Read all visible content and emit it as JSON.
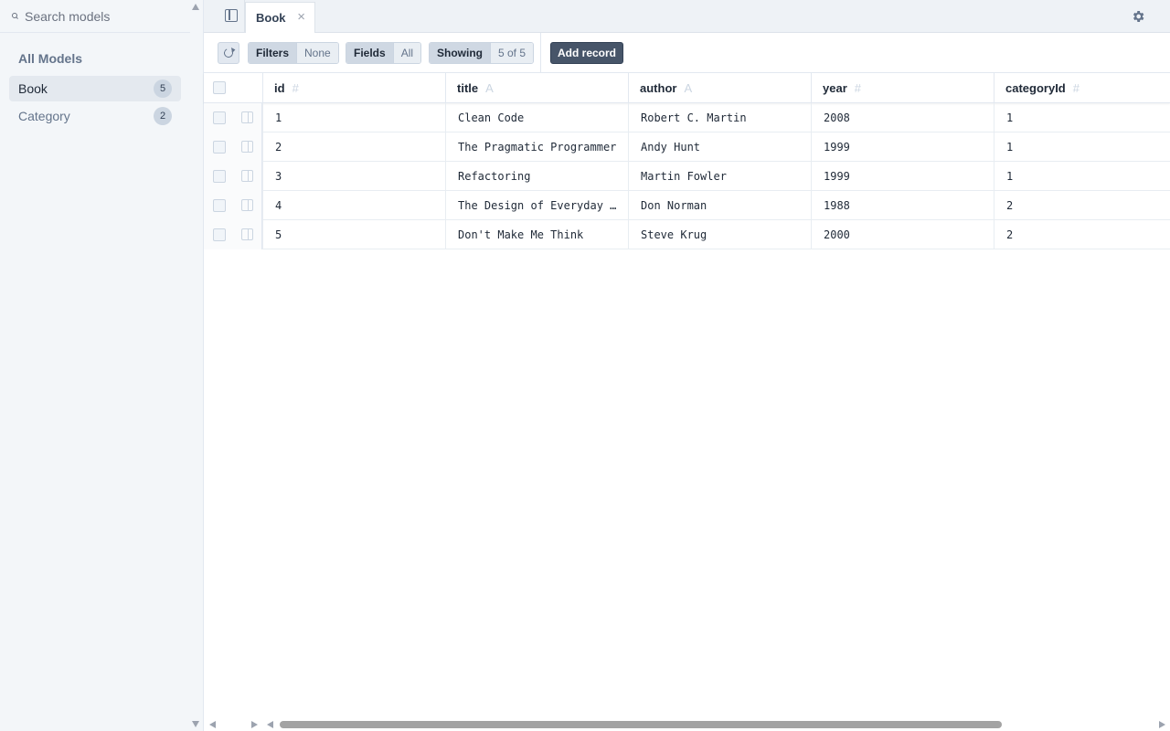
{
  "sidebar": {
    "search_placeholder": "Search models",
    "section_title": "All Models",
    "models": [
      {
        "name": "Book",
        "count": "5",
        "active": true
      },
      {
        "name": "Category",
        "count": "2",
        "active": false
      }
    ]
  },
  "tabs": {
    "active_tab": "Book",
    "close_symbol": "×"
  },
  "toolbar": {
    "filters_label": "Filters",
    "filters_value": "None",
    "fields_label": "Fields",
    "fields_value": "All",
    "showing_label": "Showing",
    "showing_value": "5 of 5",
    "add_record_label": "Add record"
  },
  "table": {
    "columns": [
      {
        "name": "id",
        "type_glyph": "#"
      },
      {
        "name": "title",
        "type_glyph": "A"
      },
      {
        "name": "author",
        "type_glyph": "A"
      },
      {
        "name": "year",
        "type_glyph": "#"
      },
      {
        "name": "categoryId",
        "type_glyph": "#"
      }
    ],
    "rows": [
      [
        "1",
        "Clean Code",
        "Robert C. Martin",
        "2008",
        "1"
      ],
      [
        "2",
        "The Pragmatic Programmer",
        "Andy Hunt",
        "1999",
        "1"
      ],
      [
        "3",
        "Refactoring",
        "Martin Fowler",
        "1999",
        "1"
      ],
      [
        "4",
        "The Design of Everyday Things",
        "Don Norman",
        "1988",
        "2"
      ],
      [
        "5",
        "Don't Make Me Think",
        "Steve Krug",
        "2000",
        "2"
      ]
    ]
  },
  "icons": {
    "search": "search-icon",
    "panel_toggle": "sidebar-toggle-icon",
    "settings": "gear-icon",
    "refresh": "refresh-icon",
    "expand_row": "expand-row-icon"
  },
  "colors": {
    "accent_button": "#475569",
    "sidebar_bg": "#f3f6f9",
    "active_item_bg": "#e4e9ef"
  }
}
